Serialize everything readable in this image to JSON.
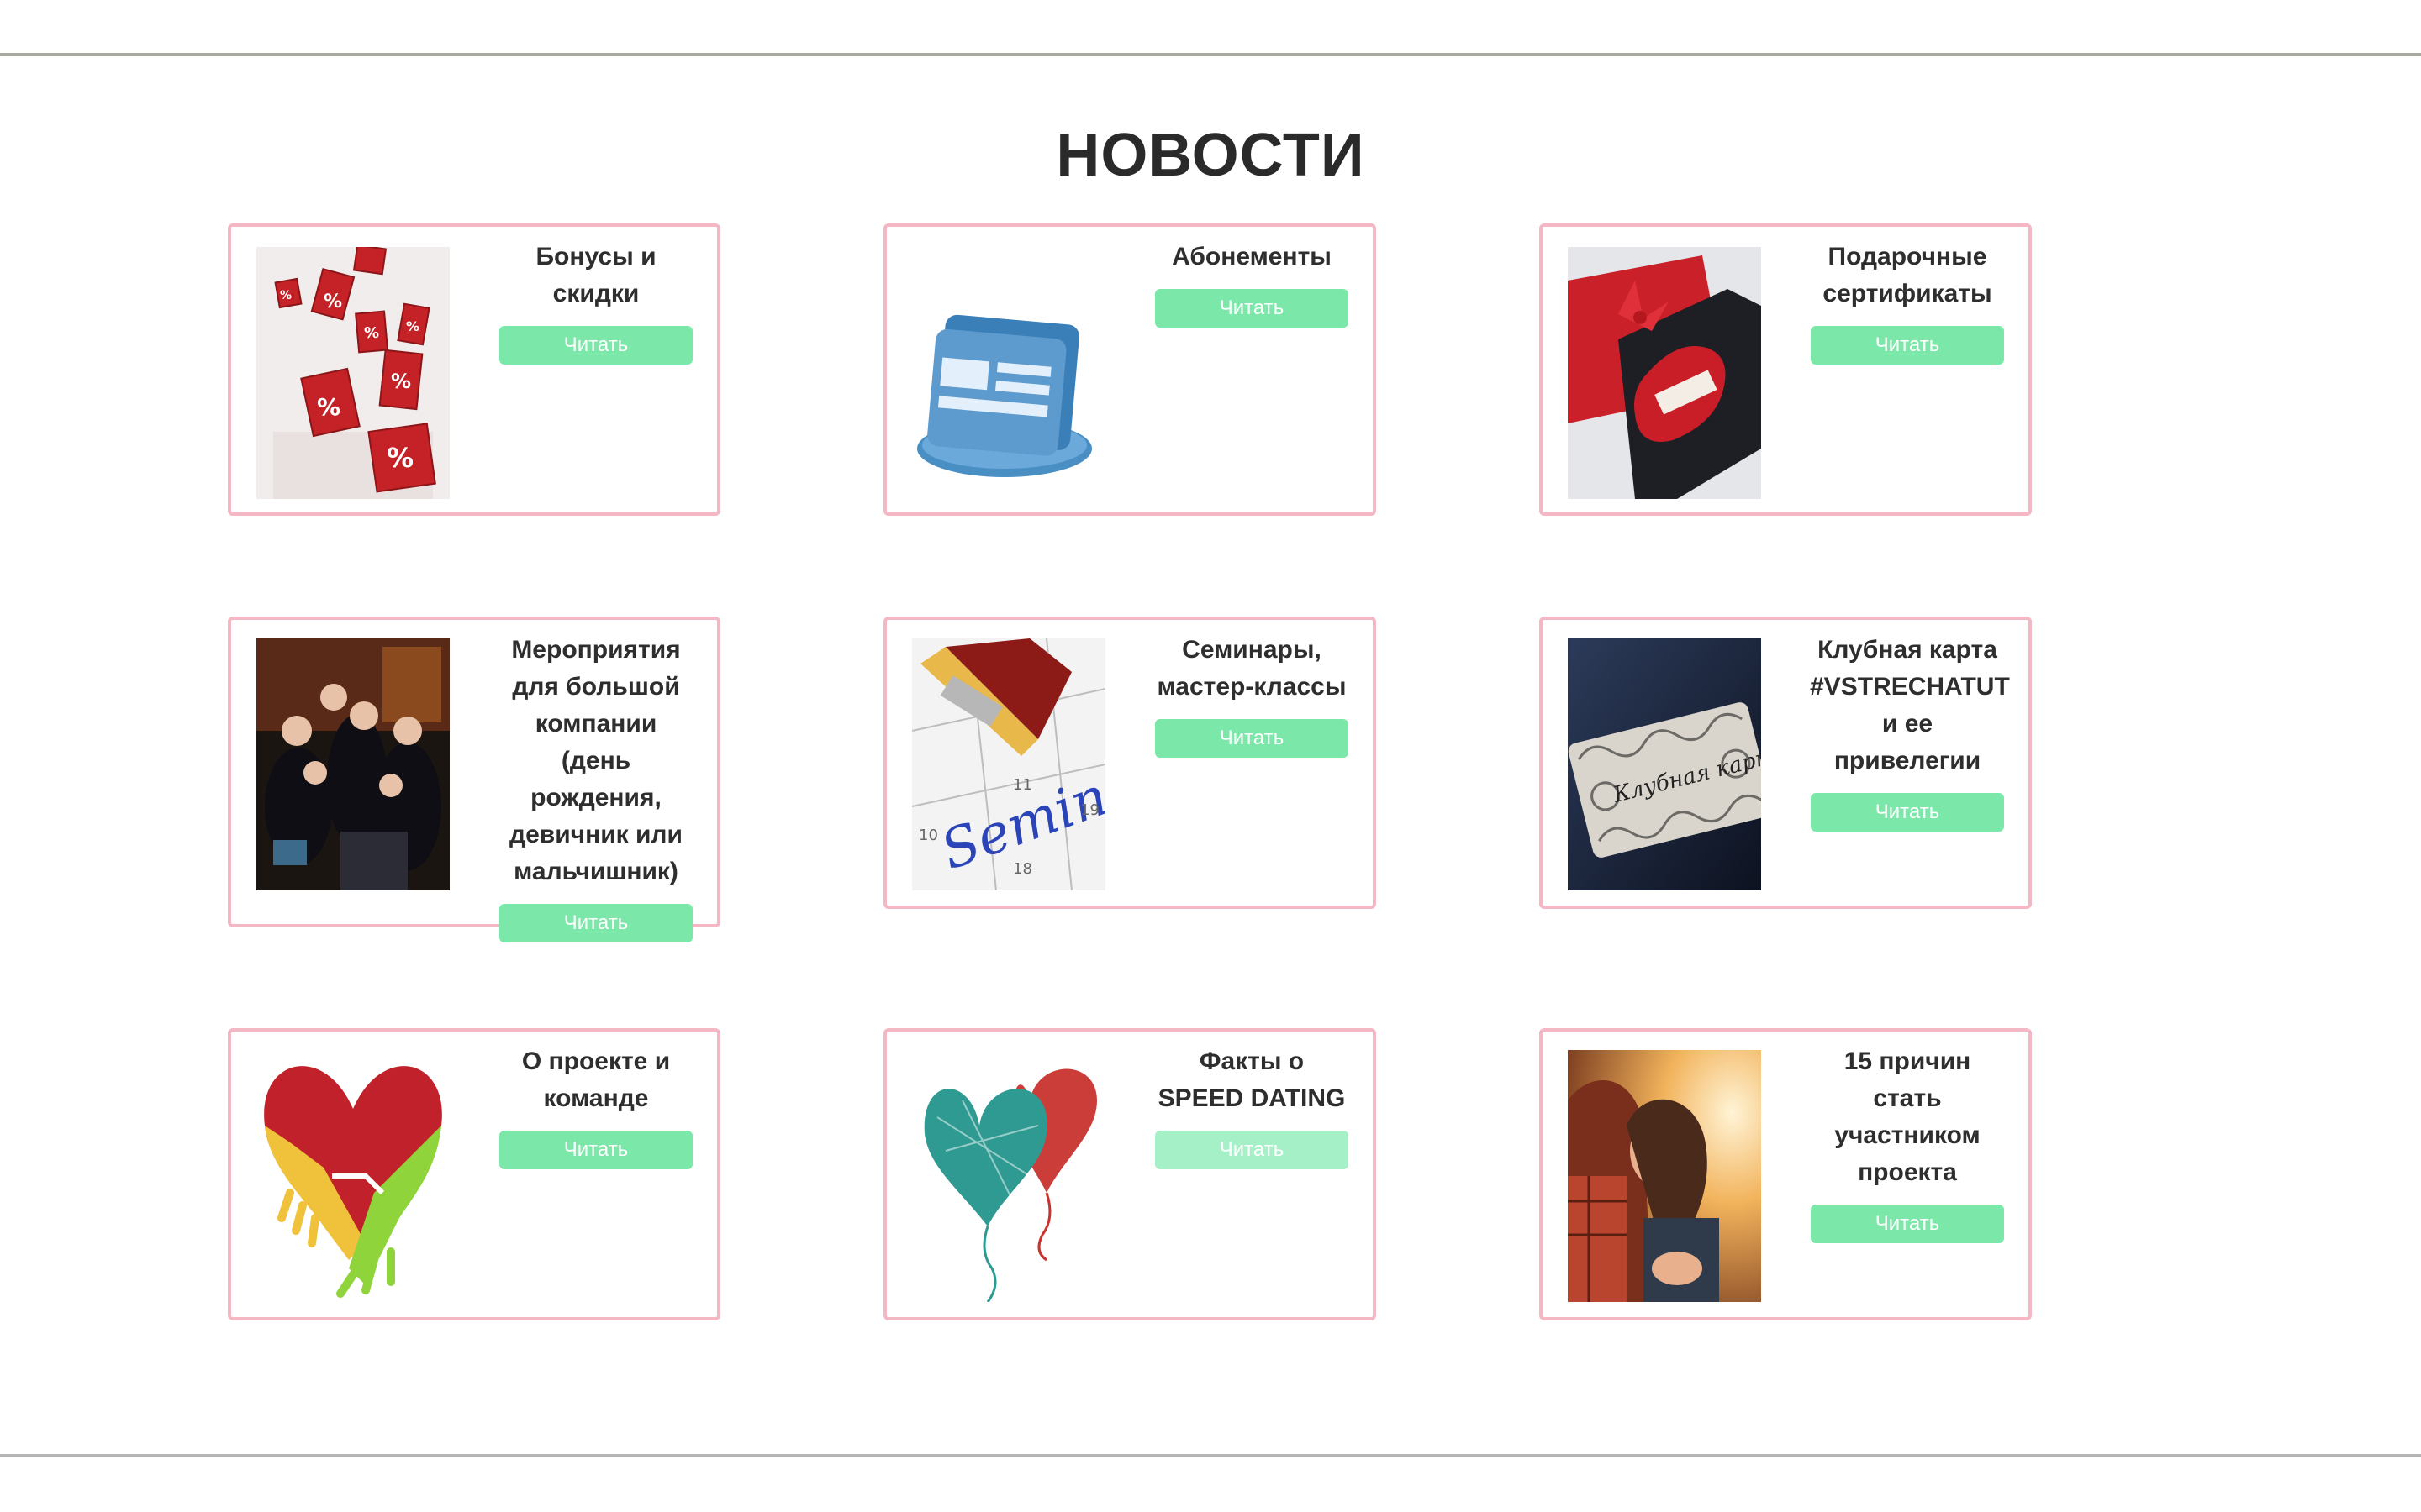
{
  "section": {
    "title": "НОВОСТИ"
  },
  "colors": {
    "card_border": "#f4b8c4",
    "button_bg": "#7be8a9",
    "button_text": "#ffffff"
  },
  "cards": [
    {
      "title": "Бонусы и скидки",
      "button": "Читать",
      "image": "percent-dice-image"
    },
    {
      "title": "Абонементы",
      "button": "Читать",
      "image": "cards-icon-image"
    },
    {
      "title": "Подарочные сертификаты",
      "button": "Читать",
      "image": "gift-certificate-image"
    },
    {
      "title": "Мероприятия для большой компании (день рождения, девичник или мальчишник)",
      "button": "Читать",
      "image": "party-group-image"
    },
    {
      "title": "Семинары, мастер-классы",
      "button": "Читать",
      "image": "seminar-calendar-image"
    },
    {
      "title": "Клубная карта #VSTRECHATUT и ее привелегии",
      "button": "Читать",
      "image": "club-card-image"
    },
    {
      "title": "О проекте и команде",
      "button": "Читать",
      "image": "heart-hands-image"
    },
    {
      "title": "Факты о SPEED DATING",
      "button": "Читать",
      "image": "heart-balloons-image"
    },
    {
      "title": "15 причин стать участником проекта",
      "button": "Читать",
      "image": "couple-photo-image"
    }
  ]
}
